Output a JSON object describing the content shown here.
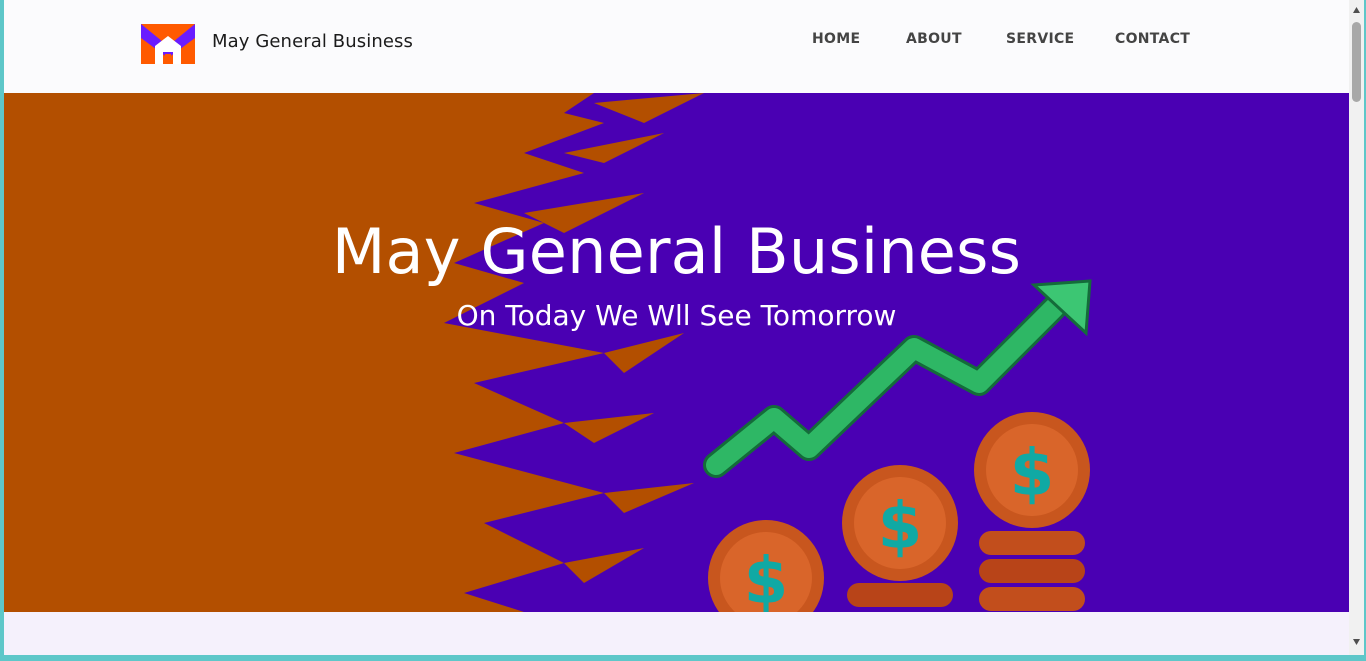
{
  "brand": {
    "name": "May General Business",
    "logo_icon": "mg-logo-icon"
  },
  "nav": {
    "items": [
      {
        "label": "HOME"
      },
      {
        "label": "ABOUT"
      },
      {
        "label": "SERVICE"
      },
      {
        "label": "CONTACT"
      }
    ]
  },
  "hero": {
    "title": "May General Business",
    "subtitle": "On Today We Wll See Tomorrow",
    "colors": {
      "purple": "#4a00b3",
      "orange": "#b34f00",
      "arrow": "#2eb765",
      "coin": "#c8561e",
      "dollar": "#10a9a4"
    }
  }
}
